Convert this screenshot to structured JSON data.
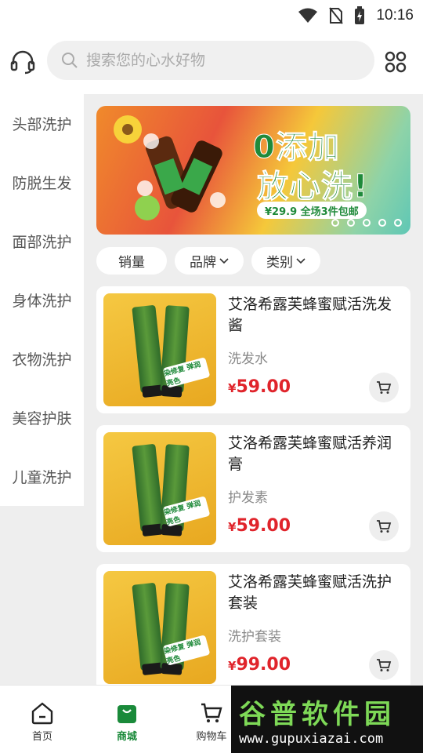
{
  "status": {
    "time": "10:16"
  },
  "search": {
    "placeholder": "搜索您的心水好物"
  },
  "sidebar": {
    "items": [
      "头部洗护",
      "防脱生发",
      "面部洗护",
      "身体洗护",
      "衣物洗护",
      "美容护肤",
      "儿童洗护"
    ]
  },
  "banner": {
    "line1": "0添加",
    "line2": "放心洗!",
    "strip": "¥29.9 全场3件包邮",
    "slides": 5
  },
  "filters": {
    "sales": "销量",
    "brand": "品牌",
    "category": "类别"
  },
  "products": [
    {
      "title": "艾洛希露芙蜂蜜赋活洗发酱",
      "category": "洗发水",
      "price": "59.00",
      "yen": "¥",
      "tag": "染修复 弹润亮色"
    },
    {
      "title": "艾洛希露芙蜂蜜赋活养润膏",
      "category": "护发素",
      "price": "59.00",
      "yen": "¥",
      "tag": "染修复 弹润亮色"
    },
    {
      "title": "艾洛希露芙蜂蜜赋活洗护套装",
      "category": "洗护套装",
      "price": "99.00",
      "yen": "¥",
      "tag": "染修复 弹润亮色"
    }
  ],
  "tabs": {
    "home": "首页",
    "mall": "商城",
    "cart": "购物车"
  },
  "watermark": {
    "brand": "谷普软件园",
    "url": "www.gupuxiazai.com"
  },
  "colors": {
    "accent": "#1a8a3a",
    "price": "#e0242b"
  }
}
